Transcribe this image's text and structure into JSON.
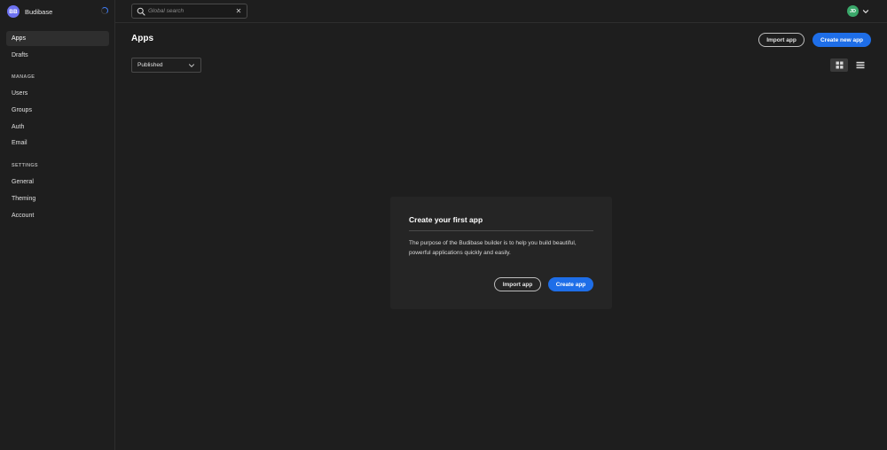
{
  "sidebar": {
    "brand_initials": "BB",
    "brand_name": "Budibase",
    "items": [
      {
        "label": "Apps",
        "active": true
      },
      {
        "label": "Drafts",
        "active": false
      }
    ],
    "manage_label": "MANAGE",
    "manage_items": [
      {
        "label": "Users"
      },
      {
        "label": "Groups"
      },
      {
        "label": "Auth"
      },
      {
        "label": "Email"
      }
    ],
    "settings_label": "SETTINGS",
    "settings_items": [
      {
        "label": "General"
      },
      {
        "label": "Theming"
      },
      {
        "label": "Account"
      }
    ]
  },
  "topbar": {
    "search_placeholder": "Global search",
    "user_initials": "JD"
  },
  "main": {
    "title": "Apps",
    "import_label": "Import app",
    "create_label": "Create new app",
    "filter_value": "Published"
  },
  "empty_state": {
    "title": "Create your first app",
    "body": "The purpose of the Budibase builder is to help you build beautiful, powerful applications quickly and easily.",
    "import_label": "Import app",
    "create_label": "Create app"
  },
  "colors": {
    "accent": "#1e6ee8",
    "brand_avatar": "#6d72f2",
    "user_avatar": "#3aa86a",
    "background": "#1e1e1e"
  }
}
